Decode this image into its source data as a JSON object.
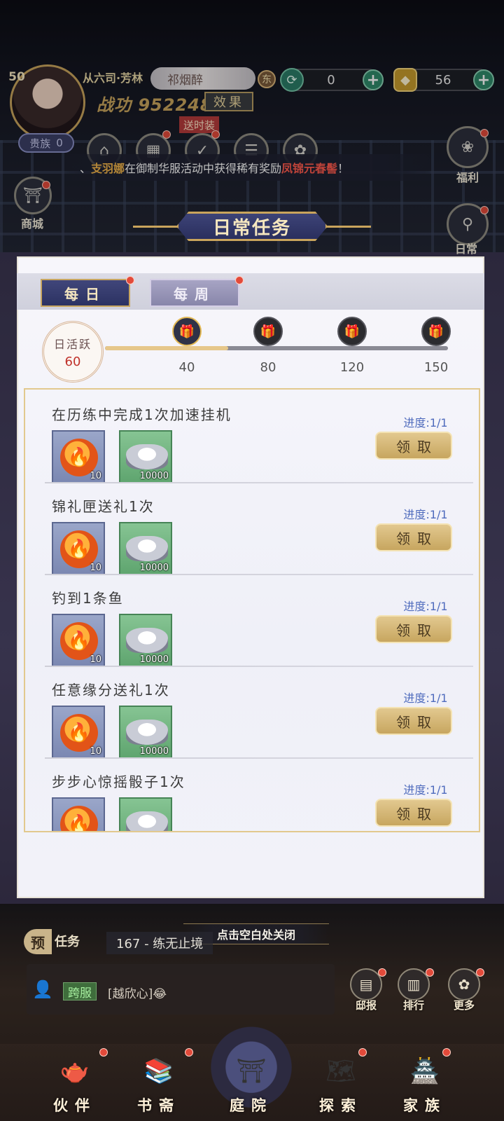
{
  "player": {
    "level": "50",
    "rank_title": "从六司·芳林",
    "name": "祁烟醉",
    "server_tag": "东",
    "power_label": "战功",
    "power_value": "952248",
    "effect_label": "效果",
    "gift_outfit_label": "送时装",
    "noble_label": "贵族",
    "noble_value": "0"
  },
  "resources": [
    {
      "icon": "cycle-currency-icon",
      "value": "0"
    },
    {
      "icon": "gold-ingot-icon",
      "value": "56"
    }
  ],
  "side_menu": {
    "mall_label": "商城",
    "welfare_label": "福利",
    "daily_label": "日常"
  },
  "broadcast": {
    "player": "支羽娜",
    "text_a": " 在御制华服活动中获得稀有奖励 ",
    "reward": "凤锦元春髻",
    "text_b": " ！"
  },
  "panel": {
    "title": "日常任务",
    "tabs": [
      {
        "label": "每日",
        "active": true
      },
      {
        "label": "每周",
        "active": false
      }
    ],
    "activity_label": "日活跃",
    "activity_value": "60",
    "activity_max": 150,
    "milestones": [
      "40",
      "80",
      "120",
      "150"
    ],
    "tasks": [
      {
        "name": "在历练中完成1次加速挂机",
        "progress": "进度:1/1",
        "claim": "领取",
        "rewards": [
          "10",
          "10000"
        ]
      },
      {
        "name": "锦礼匣送礼1次",
        "progress": "进度:1/1",
        "claim": "领取",
        "rewards": [
          "10",
          "10000"
        ]
      },
      {
        "name": "钓到1条鱼",
        "progress": "进度:1/1",
        "claim": "领取",
        "rewards": [
          "10",
          "10000"
        ]
      },
      {
        "name": "任意缘分送礼1次",
        "progress": "进度:1/1",
        "claim": "领取",
        "rewards": [
          "10",
          "10000"
        ]
      },
      {
        "name": "步步心惊摇骰子1次",
        "progress": "进度:1/1",
        "claim": "领取",
        "rewards": [
          "",
          ""
        ]
      }
    ],
    "close_hint": "点击空白处关闭"
  },
  "quest_bar": {
    "prefix": "预",
    "tag": "任务",
    "current": "167 - 练无止境"
  },
  "chat": {
    "channel": "跨服",
    "message": "[越欣心]😂"
  },
  "sys_buttons": [
    {
      "label": "邸报",
      "icon": "newspaper-icon"
    },
    {
      "label": "排行",
      "icon": "ranking-icon"
    },
    {
      "label": "更多",
      "icon": "more-icon"
    }
  ],
  "nav": [
    {
      "label": "伙伴",
      "icon": "teapot-icon"
    },
    {
      "label": "书斋",
      "icon": "books-icon"
    },
    {
      "label": "庭院",
      "icon": "pavilion-icon"
    },
    {
      "label": "探索",
      "icon": "explore-icon"
    },
    {
      "label": "家族",
      "icon": "family-icon"
    }
  ]
}
